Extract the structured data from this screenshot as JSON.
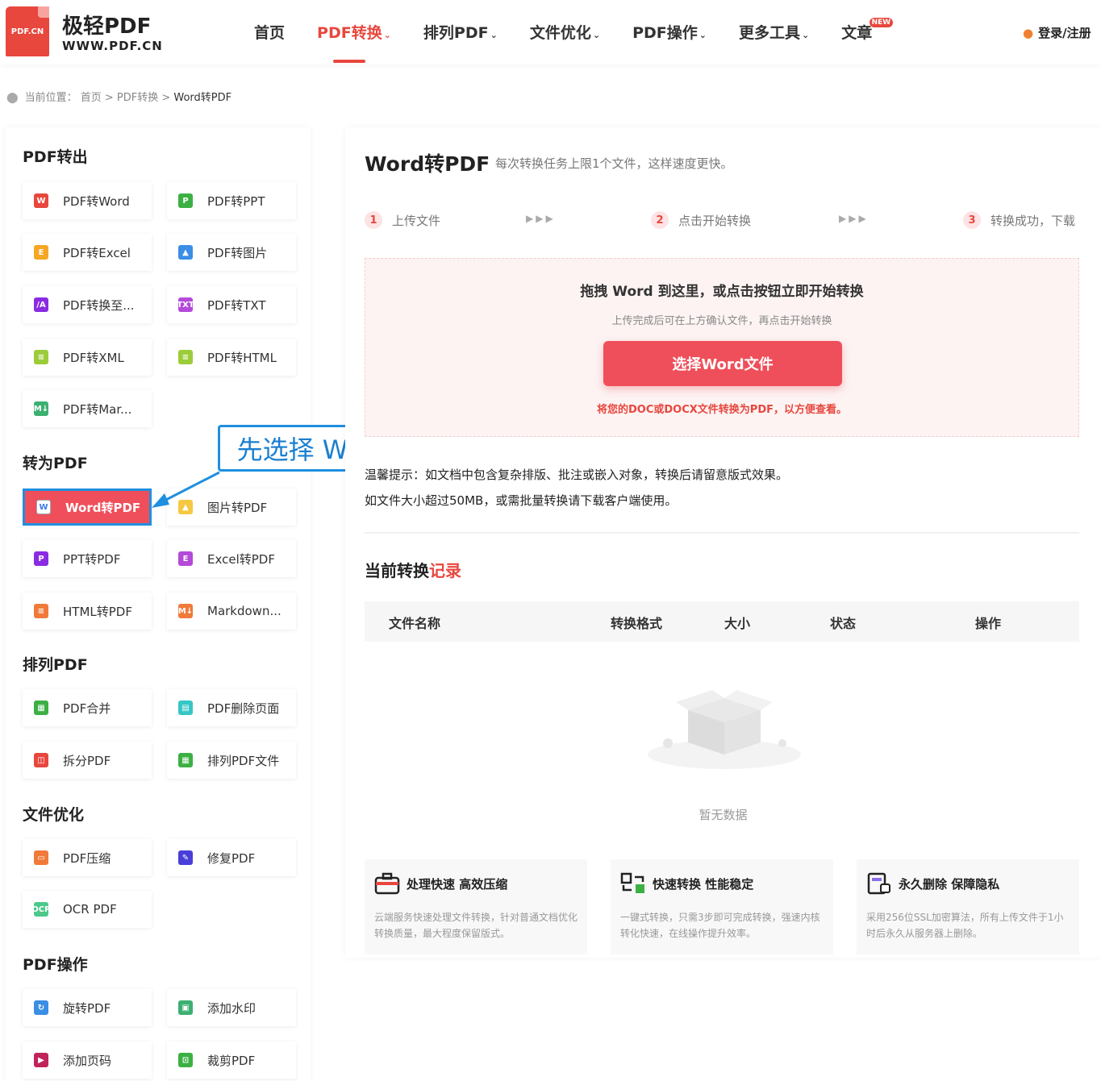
{
  "header": {
    "logo_badge": "PDF.CN",
    "logo_title": "极轻PDF",
    "logo_sub": "WWW.PDF.CN",
    "nav": [
      {
        "label": "首页",
        "caret": ""
      },
      {
        "label": "PDF转换",
        "caret": "⌄"
      },
      {
        "label": "排列PDF",
        "caret": "⌄"
      },
      {
        "label": "文件优化",
        "caret": "⌄"
      },
      {
        "label": "PDF操作",
        "caret": "⌄"
      },
      {
        "label": "更多工具",
        "caret": "⌄"
      },
      {
        "label": "文章",
        "caret": ""
      }
    ],
    "new_badge": "NEW",
    "login": "登录/注册"
  },
  "breadcrumb": {
    "prefix": "当前位置：",
    "path": "首页 > PDF转换 > ",
    "current": "Word转PDF"
  },
  "sidebar": {
    "sections": [
      {
        "title": "PDF转出"
      },
      {
        "title": "转为PDF"
      },
      {
        "title": "排列PDF"
      },
      {
        "title": "文件优化"
      },
      {
        "title": "PDF操作"
      }
    ],
    "tools": [
      {
        "label": "PDF转Word",
        "icon": "W",
        "color": "#e8473e"
      },
      {
        "label": "PDF转PPT",
        "icon": "P",
        "color": "#3cb043"
      },
      {
        "label": "PDF转Excel",
        "icon": "E",
        "color": "#f5a623"
      },
      {
        "label": "PDF转图片",
        "icon": "▲",
        "color": "#3a8ee6"
      },
      {
        "label": "PDF转换至...",
        "icon": "/A",
        "color": "#8a2be2"
      },
      {
        "label": "PDF转TXT",
        "icon": "TXT",
        "color": "#b44ad9"
      },
      {
        "label": "PDF转XML",
        "icon": "≡",
        "color": "#9ccc3a"
      },
      {
        "label": "PDF转HTML",
        "icon": "≡",
        "color": "#9ccc3a"
      },
      {
        "label": "PDF转Mar...",
        "icon": "M↓",
        "color": "#3cb071"
      },
      {
        "label": "Word转PDF",
        "icon": "W",
        "color": "#3a7de8"
      },
      {
        "label": "图片转PDF",
        "icon": "▲",
        "color": "#f5c842"
      },
      {
        "label": "PPT转PDF",
        "icon": "P",
        "color": "#8a2be2"
      },
      {
        "label": "Excel转PDF",
        "icon": "E",
        "color": "#b44ad9"
      },
      {
        "label": "HTML转PDF",
        "icon": "≡",
        "color": "#f07a3a"
      },
      {
        "label": "Markdown...",
        "icon": "M↓",
        "color": "#f07a3a"
      },
      {
        "label": "PDF合并",
        "icon": "▦",
        "color": "#3cb043"
      },
      {
        "label": "PDF删除页面",
        "icon": "▤",
        "color": "#36c6c6"
      },
      {
        "label": "拆分PDF",
        "icon": "◫",
        "color": "#e8473e"
      },
      {
        "label": "排列PDF文件",
        "icon": "▦",
        "color": "#3cb043"
      },
      {
        "label": "PDF压缩",
        "icon": "▭",
        "color": "#f07a3a"
      },
      {
        "label": "修复PDF",
        "icon": "✎",
        "color": "#4a3ed9"
      },
      {
        "label": "OCR PDF",
        "icon": "OCR",
        "color": "#4cc98a"
      },
      {
        "label": "旋转PDF",
        "icon": "↻",
        "color": "#3a8ee6"
      },
      {
        "label": "添加水印",
        "icon": "▣",
        "color": "#3cb071"
      },
      {
        "label": "添加页码",
        "icon": "▶",
        "color": "#c0245a"
      },
      {
        "label": "裁剪PDF",
        "icon": "⊡",
        "color": "#3cb043"
      }
    ]
  },
  "annotation": {
    "text": "先选择 Word转PDF"
  },
  "main": {
    "title": "Word转PDF",
    "hint": "每次转换任务上限1个文件，这样速度更快。",
    "steps": [
      {
        "num": "1",
        "label": "上传文件"
      },
      {
        "num": "2",
        "label": "点击开始转换"
      },
      {
        "num": "3",
        "label": "转换成功，下载"
      }
    ],
    "step_arrow": "▶▶▶",
    "drop": {
      "title": "拖拽 Word 到这里，或点击按钮立即开始转换",
      "sub": "上传完成后可在上方确认文件，再点击开始转换",
      "button": "选择Word文件",
      "note": "将您的DOC或DOCX文件转换为PDF，以方便查看。"
    },
    "tip1": "温馨提示：如文档中包含复杂排版、批注或嵌入对象，转换后请留意版式效果。",
    "tip2": "如文件大小超过50MB，或需批量转换请下载客户端使用。",
    "records_title": "当前转换",
    "records_title_hl": "记录",
    "table_headers": [
      "文件名称",
      "转换格式",
      "大小",
      "状态",
      "操作"
    ],
    "empty_text": "暂无数据",
    "features": [
      {
        "title": "处理快速 高效压缩",
        "desc": "云端服务快速处理文件转换，针对普通文档优化转换质量，最大程度保留版式。",
        "icon": "briefcase-icon"
      },
      {
        "title": "快速转换 性能稳定",
        "desc": "一键式转换，只需3步即可完成转换，强速内核转化快速，在线操作提升效率。",
        "icon": "convert-icon"
      },
      {
        "title": "永久删除 保障隐私",
        "desc": "采用256位SSL加密算法，所有上传文件于1小时后永久从服务器上删除。",
        "icon": "document-lock-icon"
      }
    ]
  }
}
